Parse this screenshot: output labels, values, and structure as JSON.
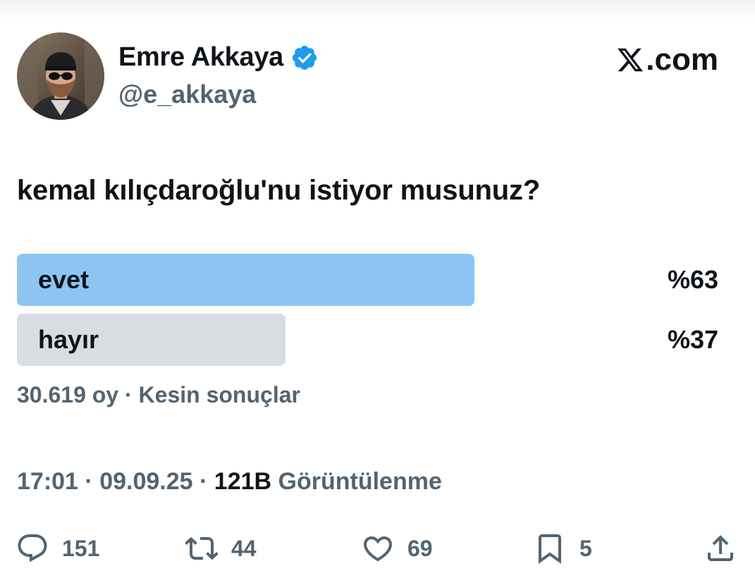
{
  "author": {
    "display_name": "Emre Akkaya",
    "handle": "@e_akkaya",
    "verified": true
  },
  "brand": {
    "text": ".com"
  },
  "tweet": {
    "text": "kemal kılıçdaroğlu'nu istiyor musunuz?"
  },
  "poll": {
    "options": [
      {
        "label": "evet",
        "percent_text": "%63",
        "percent": 63,
        "color": "#8ec5f2",
        "leading": true
      },
      {
        "label": "hayır",
        "percent_text": "%37",
        "percent": 37,
        "color": "#d9dde1",
        "leading": false
      }
    ],
    "votes": "30.619 oy",
    "separator": "·",
    "status": "Kesin sonuçlar"
  },
  "meta": {
    "time": "17:01",
    "date": "09.09.25",
    "separator": "·",
    "views_count": "121B",
    "views_label": "Görüntülenme"
  },
  "actions": {
    "reply": {
      "icon": "reply-icon",
      "count": "151"
    },
    "retweet": {
      "icon": "retweet-icon",
      "count": "44"
    },
    "like": {
      "icon": "heart-icon",
      "count": "69"
    },
    "bookmark": {
      "icon": "bookmark-icon",
      "count": "5"
    },
    "share": {
      "icon": "share-icon"
    }
  },
  "colors": {
    "text_primary": "#0f1419",
    "text_secondary": "#536471",
    "verified_blue": "#1d9bf0"
  }
}
